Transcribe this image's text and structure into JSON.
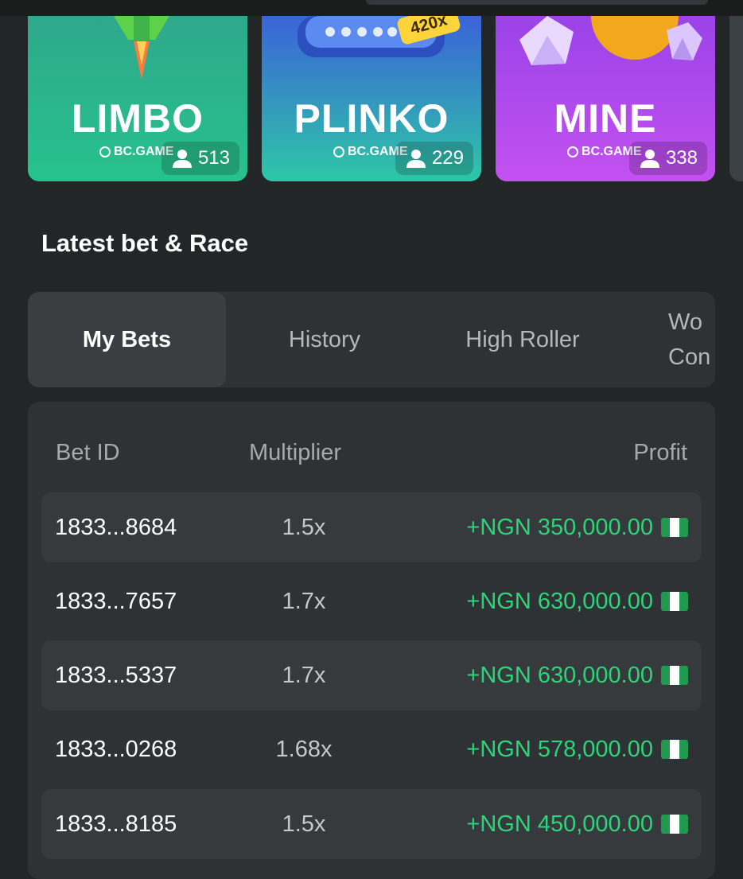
{
  "games": [
    {
      "name": "LIMBO",
      "brand": "BC.GAME",
      "players": "513"
    },
    {
      "name": "PLINKO",
      "brand": "BC.GAME",
      "players": "229",
      "badge": "420x"
    },
    {
      "name": "MINE",
      "brand": "BC.GAME",
      "players": "338"
    }
  ],
  "section_title": "Latest bet & Race",
  "tabs": [
    {
      "label": "My Bets",
      "active": true
    },
    {
      "label": "History"
    },
    {
      "label": "High Roller"
    },
    {
      "label": "Wo\nCon"
    }
  ],
  "table": {
    "headers": {
      "bet_id": "Bet ID",
      "multiplier": "Multiplier",
      "profit": "Profit"
    },
    "rows": [
      {
        "bet_id": "1833...8684",
        "multiplier": "1.5x",
        "profit": "+NGN 350,000.00"
      },
      {
        "bet_id": "1833...7657",
        "multiplier": "1.7x",
        "profit": "+NGN 630,000.00"
      },
      {
        "bet_id": "1833...5337",
        "multiplier": "1.7x",
        "profit": "+NGN 630,000.00"
      },
      {
        "bet_id": "1833...0268",
        "multiplier": "1.68x",
        "profit": "+NGN 578,000.00"
      },
      {
        "bet_id": "1833...8185",
        "multiplier": "1.5x",
        "profit": "+NGN 450,000.00"
      }
    ]
  },
  "colors": {
    "profit": "#2ed47a",
    "flag_green": "#1f9a4f",
    "background": "#232626"
  },
  "icons": {
    "players": "user-icon",
    "brand": "bc-game-logo-icon",
    "currency": "nigeria-flag-icon"
  }
}
